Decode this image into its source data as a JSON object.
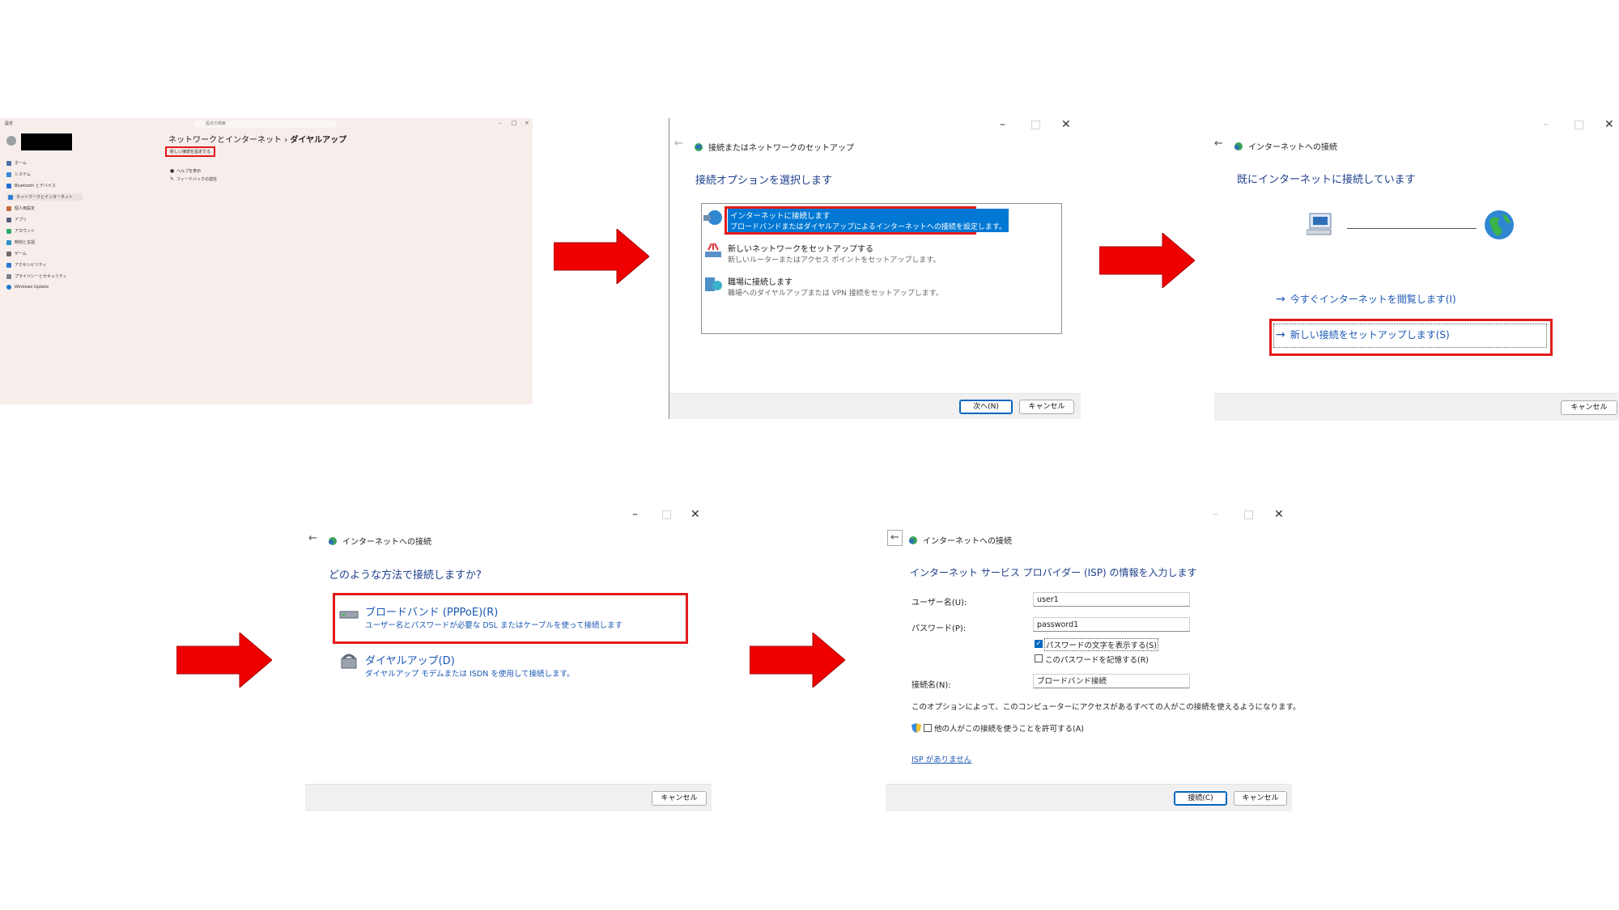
{
  "colors": {
    "accent_red": "#e21b1b",
    "link_blue": "#1c58b5",
    "heading_blue": "#1e3f8c",
    "arrow_red": "#ee0000"
  },
  "settings": {
    "app_title": "設定",
    "search_placeholder": "設定の検索",
    "nav": [
      {
        "label": "ホーム",
        "icon": "home-icon"
      },
      {
        "label": "システム",
        "icon": "system-icon"
      },
      {
        "label": "Bluetooth とデバイス",
        "icon": "bluetooth-icon"
      },
      {
        "label": "ネットワークとインターネット",
        "icon": "network-icon",
        "selected": true
      },
      {
        "label": "個人用設定",
        "icon": "brush-icon"
      },
      {
        "label": "アプリ",
        "icon": "apps-icon"
      },
      {
        "label": "アカウント",
        "icon": "account-icon"
      },
      {
        "label": "時刻と言語",
        "icon": "clock-icon"
      },
      {
        "label": "ゲーム",
        "icon": "game-icon"
      },
      {
        "label": "アクセシビリティ",
        "icon": "accessibility-icon"
      },
      {
        "label": "プライバシーとセキュリティ",
        "icon": "shield-icon"
      },
      {
        "label": "Windows Update",
        "icon": "update-icon"
      }
    ],
    "breadcrumb_parent": "ネットワークとインターネット",
    "breadcrumb_sep": "›",
    "breadcrumb_current": "ダイヤルアップ",
    "new_connection_button": "新しい接続を設定する",
    "links": [
      "ヘルプを表示",
      "フィードバックの送信"
    ]
  },
  "dialog1": {
    "title": "接続またはネットワークのセットアップ",
    "heading": "接続オプションを選択します",
    "options": [
      {
        "title": "インターネットに接続します",
        "sub": "ブロードバンドまたはダイヤルアップによるインターネットへの接続を設定します。"
      },
      {
        "title": "新しいネットワークをセットアップする",
        "sub": "新しいルーターまたはアクセス ポイントをセットアップします。"
      },
      {
        "title": "職場に接続します",
        "sub": "職場へのダイヤルアップまたは VPN 接続をセットアップします。"
      }
    ],
    "next_button": "次へ(N)",
    "cancel_button": "キャンセル"
  },
  "dialog2": {
    "title": "インターネットへの接続",
    "heading": "既にインターネットに接続しています",
    "browse_link": "今すぐインターネットを閲覧します(I)",
    "setup_link": "新しい接続をセットアップします(S)",
    "cancel_button": "キャンセル"
  },
  "dialog3": {
    "title": "インターネットへの接続",
    "heading": "どのような方法で接続しますか?",
    "options": [
      {
        "title": "ブロードバンド (PPPoE)(R)",
        "sub": "ユーザー名とパスワードが必要な DSL またはケーブルを使って接続します"
      },
      {
        "title": "ダイヤルアップ(D)",
        "sub": "ダイヤルアップ モデムまたは ISDN を使用して接続します。"
      }
    ],
    "cancel_button": "キャンセル"
  },
  "dialog4": {
    "title": "インターネットへの接続",
    "heading": "インターネット サービス プロバイダー (ISP) の情報を入力します",
    "username_label": "ユーザー名(U):",
    "username_value": "user1",
    "password_label": "パスワード(P):",
    "password_value": "password1",
    "show_chars_label": "パスワードの文字を表示する(S)",
    "show_chars_checked": true,
    "remember_label": "このパスワードを記憶する(R)",
    "remember_checked": false,
    "connection_name_label": "接続名(N):",
    "connection_name_value": "ブロードバンド接続",
    "note": "このオプションによって、このコンピューターにアクセスがあるすべての人がこの接続を使えるようになります。",
    "allow_others_label": "他の人がこの接続を使うことを許可する(A)",
    "allow_others_checked": false,
    "no_isp_link": "ISP がありません",
    "connect_button": "接続(C)",
    "cancel_button": "キャンセル"
  }
}
